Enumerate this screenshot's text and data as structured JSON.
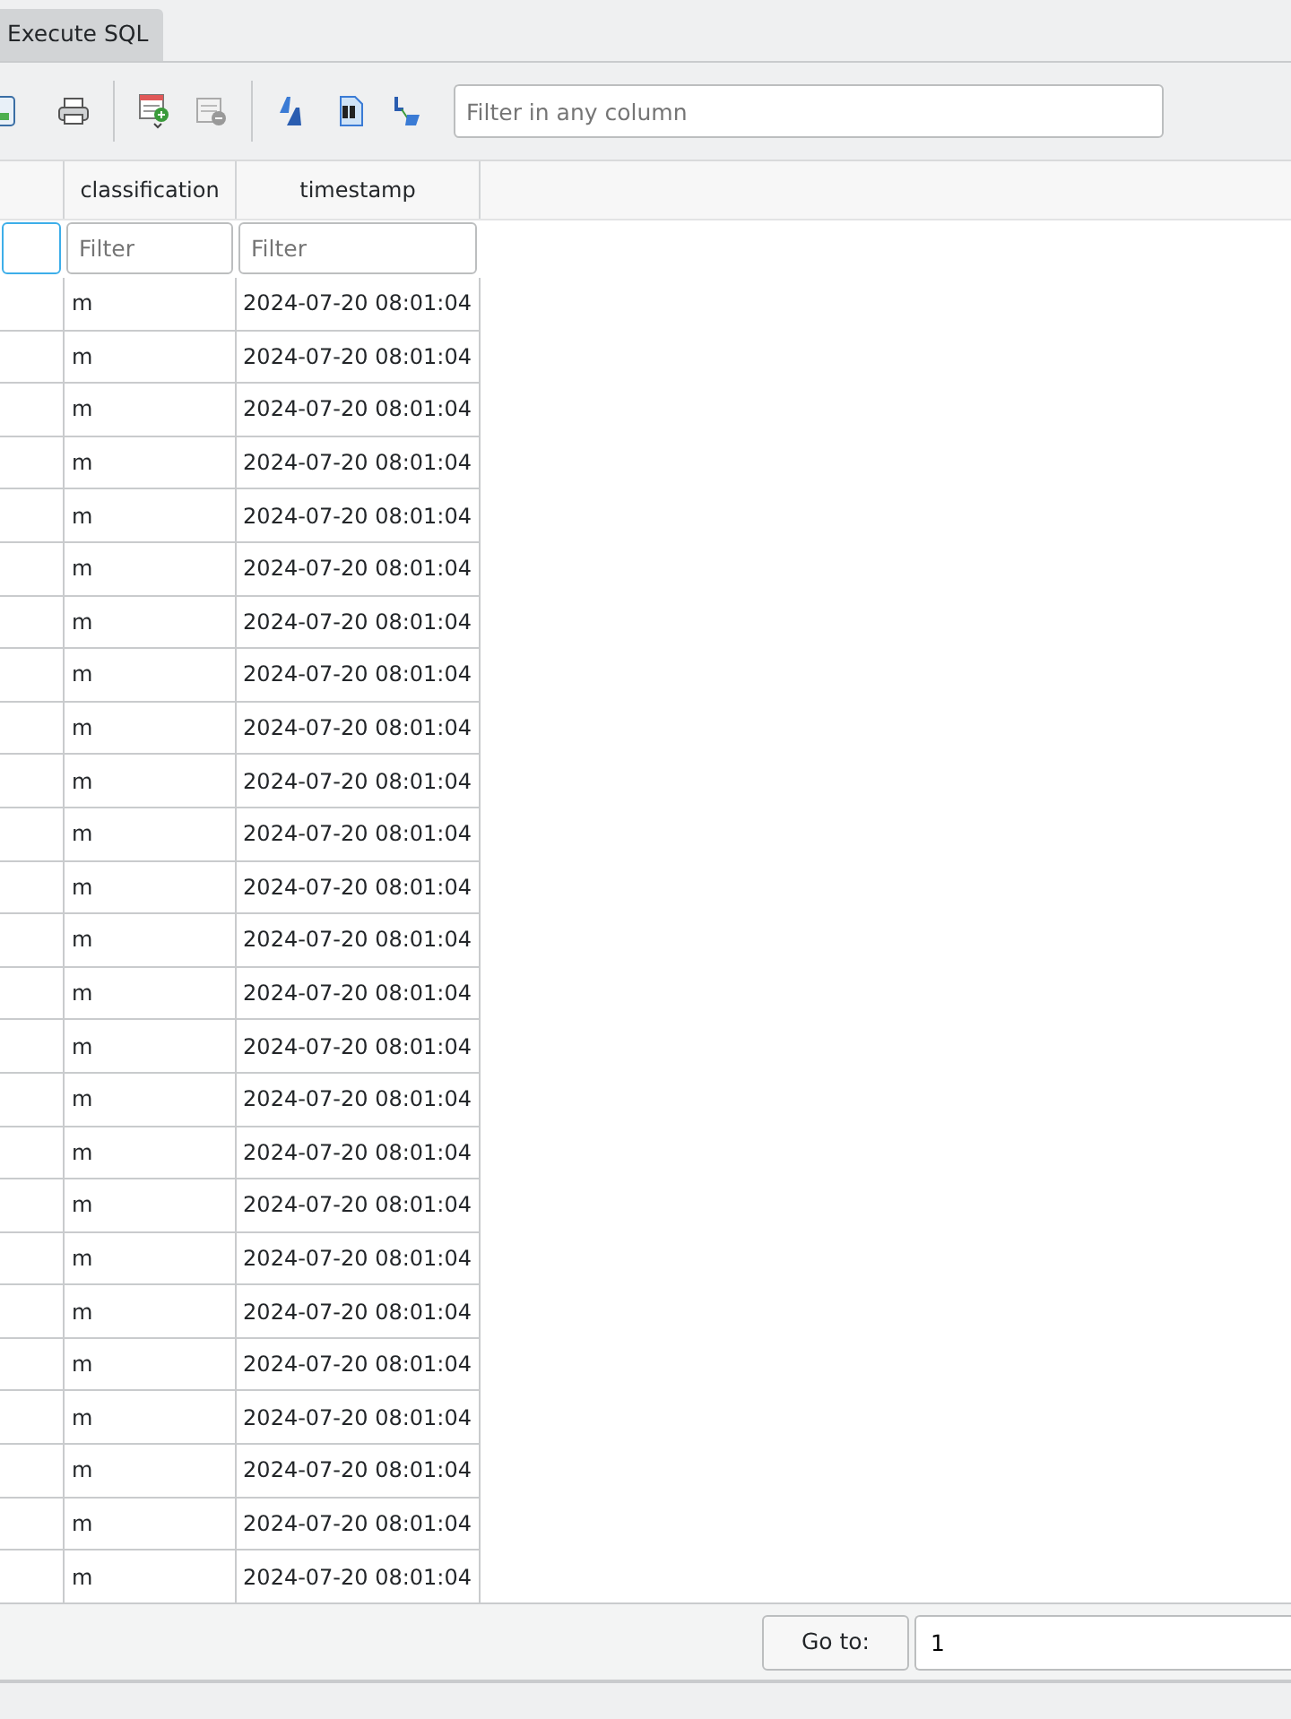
{
  "tabs": [
    {
      "label": "Execute SQL",
      "selected": false
    }
  ],
  "toolbar": {
    "filter": {
      "placeholder": "Filter in any column"
    }
  },
  "table": {
    "columns": [
      {
        "focused": true
      },
      {
        "label": "classification",
        "filter_placeholder": "Filter",
        "focused": false
      },
      {
        "label": "timestamp",
        "filter_placeholder": "Filter",
        "focused": false
      }
    ],
    "rows": [
      [
        "m",
        "2024-07-20 08:01:04"
      ],
      [
        "m",
        "2024-07-20 08:01:04"
      ],
      [
        "m",
        "2024-07-20 08:01:04"
      ],
      [
        "m",
        "2024-07-20 08:01:04"
      ],
      [
        "m",
        "2024-07-20 08:01:04"
      ],
      [
        "m",
        "2024-07-20 08:01:04"
      ],
      [
        "m",
        "2024-07-20 08:01:04"
      ],
      [
        "m",
        "2024-07-20 08:01:04"
      ],
      [
        "m",
        "2024-07-20 08:01:04"
      ],
      [
        "m",
        "2024-07-20 08:01:04"
      ],
      [
        "m",
        "2024-07-20 08:01:04"
      ],
      [
        "m",
        "2024-07-20 08:01:04"
      ],
      [
        "m",
        "2024-07-20 08:01:04"
      ],
      [
        "m",
        "2024-07-20 08:01:04"
      ],
      [
        "m",
        "2024-07-20 08:01:04"
      ],
      [
        "m",
        "2024-07-20 08:01:04"
      ],
      [
        "m",
        "2024-07-20 08:01:04"
      ],
      [
        "m",
        "2024-07-20 08:01:04"
      ],
      [
        "m",
        "2024-07-20 08:01:04"
      ],
      [
        "m",
        "2024-07-20 08:01:04"
      ],
      [
        "m",
        "2024-07-20 08:01:04"
      ],
      [
        "m",
        "2024-07-20 08:01:04"
      ],
      [
        "m",
        "2024-07-20 08:01:04"
      ],
      [
        "m",
        "2024-07-20 08:01:04"
      ],
      [
        "m",
        "2024-07-20 08:01:04"
      ]
    ]
  },
  "footer": {
    "goto_button": "Go to:",
    "goto_value": "1"
  }
}
